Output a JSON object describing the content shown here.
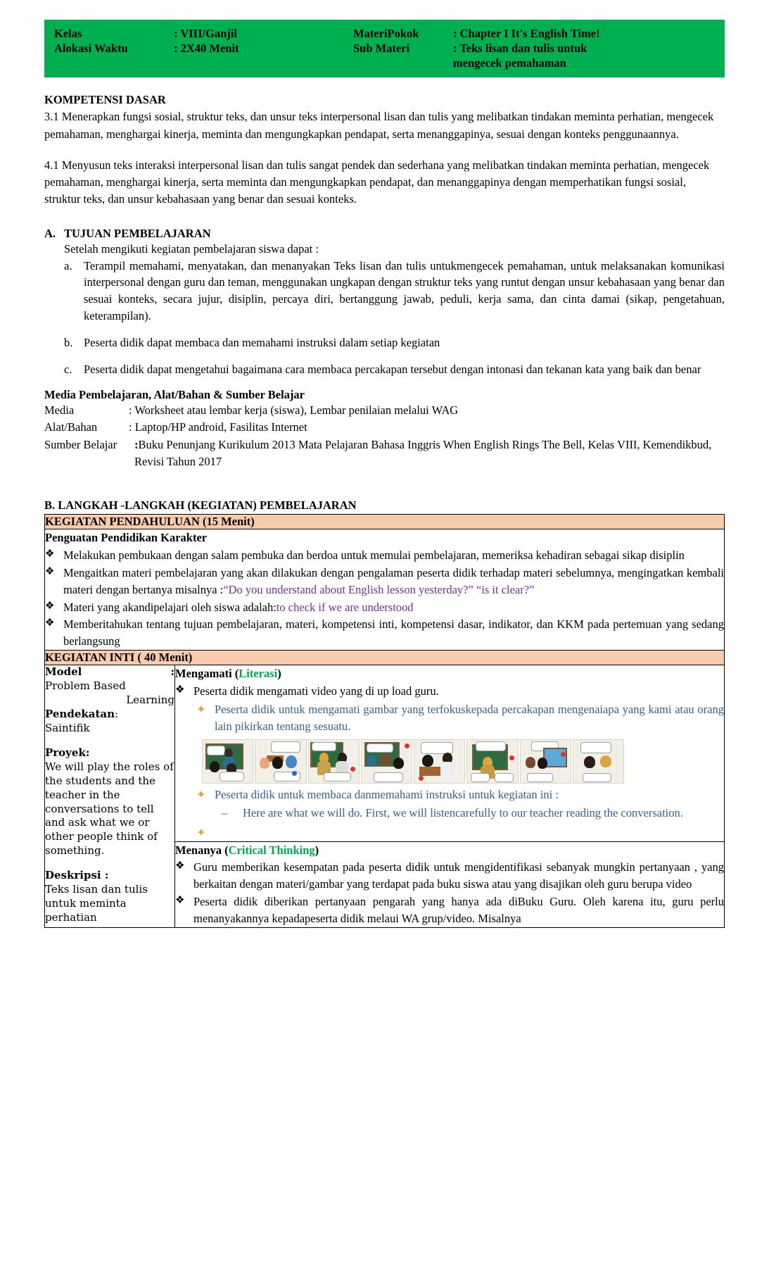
{
  "header": {
    "rows": [
      {
        "label": "Kelas",
        "value": ": VIII/Ganjil",
        "label2": "MateriPokok",
        "value2": ": Chapter I It's English Time!"
      },
      {
        "label": "Alokasi Waktu",
        "value": ": 2X40 Menit",
        "label2": "Sub Materi",
        "value2": ": Teks lisan dan tulis untuk"
      }
    ],
    "continuation": "mengecek  pemahaman",
    "bg_color": "#00B050"
  },
  "kompetensi": {
    "title": "KOMPETENSI DASAR",
    "items": [
      "3.1 Menerapkan fungsi sosial, struktur teks, dan unsur teks interpersonal lisan dan tulis yang melibatkan tindakan meminta perhatian, mengecek pemahaman, menghargai kinerja, meminta dan mengungkapkan pendapat, serta menanggapinya, sesuai dengan konteks penggunaannya.",
      "4.1 Menyusun teks interaksi interpersonal lisan dan tulis sangat pendek dan sederhana yang melibatkan tindakan meminta perhatian, mengecek pemahaman, menghargai kinerja, serta meminta dan mengungkapkan pendapat, dan menanggapinya dengan memperhatikan fungsi sosial, struktur teks, dan unsur kebahasaan yang benar dan sesuai konteks."
    ]
  },
  "tujuan": {
    "mark": "A.",
    "title": "TUJUAN PEMBELAJARAN",
    "intro": "Setelah mengikuti kegiatan pembelajaran siswa dapat :",
    "items": [
      {
        "mark": "a.",
        "text": "Terampil memahami, menyatakan, dan menanyakan Teks lisan dan tulis untukmengecek pemahaman, untuk melaksanakan komunikasi interpersonal dengan guru dan teman, menggunakan ungkapan dengan struktur teks yang runtut dengan unsur kebahasaan yang benar dan sesuai konteks, secara jujur, disiplin, percaya diri, bertanggung jawab, peduli, kerja sama, dan cinta damai (sikap, pengetahuan, keterampilan)."
      },
      {
        "mark": "b.",
        "text": "Peserta didik dapat membaca dan memahami instruksi dalam setiap kegiatan"
      },
      {
        "mark": "c.",
        "text": "Peserta didik dapat mengetahui bagaimana cara membaca percakapan tersebut dengan intonasi dan tekanan kata yang baik dan benar"
      }
    ]
  },
  "media": {
    "title": "Media Pembelajaran, Alat/Bahan & Sumber Belajar",
    "rows": [
      {
        "key": "Media",
        "value": ": Worksheet atau lembar kerja (siswa), Lembar penilaian melalui WAG"
      },
      {
        "key": "Alat/Bahan",
        "value": ": Laptop/HP android, Fasilitas Internet"
      }
    ],
    "sumber_key": "Sumber Belajar",
    "sumber_colon": ":",
    "sumber_value": "Buku Penunjang Kurikulum 2013 Mata Pelajaran Bahasa Inggris When English Rings The Bell, Kelas VIII, Kemendikbud,  Revisi Tahun 2017"
  },
  "langkah": {
    "heading": "B.   LANGKAH -LANGKAH (KEGIATAN) PEMBELAJARAN",
    "pendahuluan": {
      "band": "KEGIATAN PENDAHULUAN (15 Menit)",
      "subtitle": "Penguatan Pendidikan Karakter",
      "bullets": [
        {
          "text": "Melakukan pembukaan dengan salam pembuka dan berdoa  untuk  memulai pembelajaran, memeriksa kehadiran sebagai sikap disiplin",
          "justify": true
        },
        {
          "pre": "Mengaitkan materi pembelajaran yang akan dilakukan dengan pengalaman peserta didik terhadap materi sebelumnya, mengingatkan kembali materi dengan bertanya misalnya  :",
          "colored": "“Do you understand about English lesson yesterday?” “is it clear?”",
          "justify": true
        },
        {
          "pre": "Materi yang akandipelajari oleh siswa adalah:",
          "colored": "to check if we are understood",
          "justify": false
        },
        {
          "text": "Memberitahukan tentang tujuan pembelajaran, materi, kompetensi inti, kompetensi dasar, indikator, dan KKM pada pertemuan yang  sedang berlangsung",
          "justify": true
        }
      ]
    },
    "inti": {
      "band": "KEGIATAN INTI  ( 40 Menit)",
      "left_column": {
        "model_label": "Model",
        "model_colon": ":",
        "model_value_1": "Problem Based",
        "model_value_2": "Learning",
        "pendekatan_label": "Pendekatan",
        "pendekatan_colon": ":",
        "pendekatan_value": "Saintifik",
        "proyek_label": "Proyek:",
        "proyek_value": "We will play the roles of the students and the teacher in the conversations to tell and ask what we or other people think of something.",
        "deskripsi_label": "Deskripsi :",
        "deskripsi_value": "Teks lisan dan tulis untuk meminta perhatian"
      },
      "mengamati": {
        "title": "Mengamati (",
        "title_colored": "Literasi",
        "title_close": ")",
        "bullet1": "Peserta didik mengamati video yang di up load guru.",
        "sub1": "Peserta didik untuk mengamati gambar yang terfokuskepada percakapan mengenaiapa yang kami atau orang lain pikirkan tentang sesuatu.",
        "sub2": "Peserta didik untuk membaca danmemahami instruksi untuk kegiatan ini :",
        "sub2_dash": "Here are what we will do. First, we will listencarefully to our teacher reading the conversation."
      },
      "menanya": {
        "title": "Menanya (",
        "title_colored": "Critical Thinking",
        "title_close": ")",
        "bullets": [
          "Guru memberikan kesempatan pada peserta didik untuk mengidentifikasi sebanyak mungkin pertanyaan , yang berkaitan dengan materi/gambar yang terdapat pada buku siswa atau yang disajikan oleh guru berupa video",
          "Peserta didik diberikan pertanyaan pengarah yang hanya ada diBuku Guru. Oleh karena itu, guru perlu menanyakannya kepadapeserta didik melaui WA grup/video. Misalnya"
        ]
      }
    }
  },
  "icons": {
    "diamond_bullet": "❖",
    "blue_bullet": "✦",
    "dash_bullet": "–"
  },
  "colors": {
    "header_green": "#00B050",
    "band_peach": "#F8CBAD",
    "purple_text": "#7030A0",
    "blue_text": "#36618E",
    "green_text": "#00A651"
  }
}
